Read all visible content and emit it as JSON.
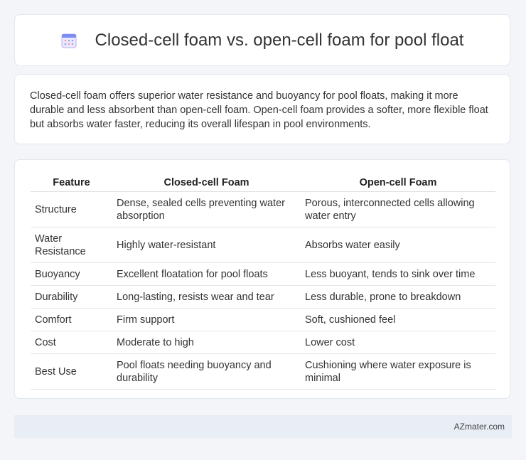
{
  "header": {
    "title": "Closed-cell foam vs. open-cell foam for pool float",
    "icon": "calendar-icon"
  },
  "summary": {
    "text": "Closed-cell foam offers superior water resistance and buoyancy for pool floats, making it more durable and less absorbent than open-cell foam. Open-cell foam provides a softer, more flexible float but absorbs water faster, reducing its overall lifespan in pool environments."
  },
  "table": {
    "headers": [
      "Feature",
      "Closed-cell Foam",
      "Open-cell Foam"
    ],
    "rows": [
      [
        "Structure",
        "Dense, sealed cells preventing water absorption",
        "Porous, interconnected cells allowing water entry"
      ],
      [
        "Water Resistance",
        "Highly water-resistant",
        "Absorbs water easily"
      ],
      [
        "Buoyancy",
        "Excellent floatation for pool floats",
        "Less buoyant, tends to sink over time"
      ],
      [
        "Durability",
        "Long-lasting, resists wear and tear",
        "Less durable, prone to breakdown"
      ],
      [
        "Comfort",
        "Firm support",
        "Soft, cushioned feel"
      ],
      [
        "Cost",
        "Moderate to high",
        "Lower cost"
      ],
      [
        "Best Use",
        "Pool floats needing buoyancy and durability",
        "Cushioning where water exposure is minimal"
      ]
    ]
  },
  "footer": {
    "brand": "AZmater.com"
  }
}
